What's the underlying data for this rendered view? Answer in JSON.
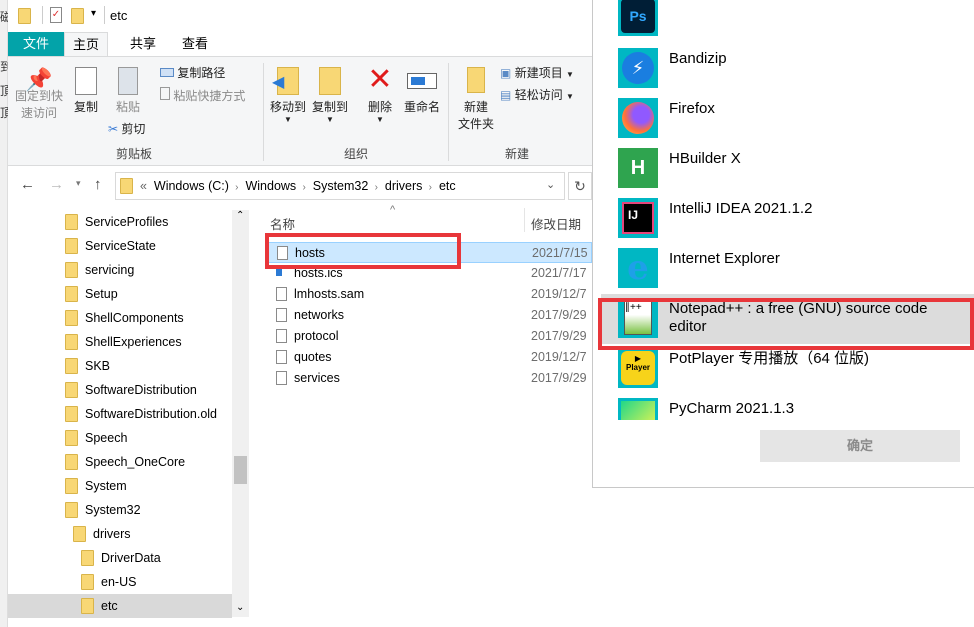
{
  "background_fragments": [
    "磁",
    "到",
    "頂",
    "頂"
  ],
  "explorer": {
    "title": "etc",
    "tabs": [
      "文件",
      "主页",
      "共享",
      "查看"
    ],
    "ribbon": {
      "pin": [
        "固定到快",
        "速访问"
      ],
      "copy": "复制",
      "paste": "粘贴",
      "copy_path": "复制路径",
      "paste_shortcut": "粘贴快捷方式",
      "cut": "剪切",
      "group_clipboard": "剪贴板",
      "move_to": "移动到",
      "copy_to": "复制到",
      "delete": "删除",
      "rename": "重命名",
      "group_organize": "组织",
      "new_folder": [
        "新建",
        "文件夹"
      ],
      "new_item": "新建项目",
      "easy_access": "轻松访问",
      "group_new": "新建"
    },
    "address": {
      "prefix": "«",
      "crumbs": [
        "Windows (C:)",
        "Windows",
        "System32",
        "drivers",
        "etc"
      ]
    },
    "tree": [
      {
        "label": "ServiceProfiles",
        "level": 0
      },
      {
        "label": "ServiceState",
        "level": 0
      },
      {
        "label": "servicing",
        "level": 0
      },
      {
        "label": "Setup",
        "level": 0
      },
      {
        "label": "ShellComponents",
        "level": 0
      },
      {
        "label": "ShellExperiences",
        "level": 0
      },
      {
        "label": "SKB",
        "level": 0
      },
      {
        "label": "SoftwareDistribution",
        "level": 0
      },
      {
        "label": "SoftwareDistribution.old",
        "level": 0
      },
      {
        "label": "Speech",
        "level": 0
      },
      {
        "label": "Speech_OneCore",
        "level": 0
      },
      {
        "label": "System",
        "level": 0
      },
      {
        "label": "System32",
        "level": 0
      },
      {
        "label": "drivers",
        "level": 1
      },
      {
        "label": "DriverData",
        "level": 2
      },
      {
        "label": "en-US",
        "level": 2
      },
      {
        "label": "etc",
        "level": 2,
        "selected": true
      }
    ],
    "columns": {
      "name": "名称",
      "date": "修改日期"
    },
    "files": [
      {
        "name": "hosts",
        "date": "2021/7/15",
        "selected": true
      },
      {
        "name": "hosts.ics",
        "date": "2021/7/17"
      },
      {
        "name": "lmhosts.sam",
        "date": "2019/12/7"
      },
      {
        "name": "networks",
        "date": "2017/9/29"
      },
      {
        "name": "protocol",
        "date": "2017/9/29"
      },
      {
        "name": "quotes",
        "date": "2019/12/7"
      },
      {
        "name": "services",
        "date": "2017/9/29"
      }
    ]
  },
  "dialog": {
    "apps": [
      {
        "name": "",
        "icon": "photoshop-icon"
      },
      {
        "name": "Bandizip",
        "icon": "bandizip-icon"
      },
      {
        "name": "Firefox",
        "icon": "firefox-icon"
      },
      {
        "name": "HBuilder X",
        "icon": "hbuilder-icon"
      },
      {
        "name": "IntelliJ IDEA 2021.1.2",
        "icon": "intellij-icon"
      },
      {
        "name": "Internet Explorer",
        "icon": "ie-icon"
      },
      {
        "name": "Notepad++ : a free (GNU) source code editor",
        "icon": "notepadpp-icon",
        "highlighted": true
      },
      {
        "name": "PotPlayer 专用播放（64 位版)",
        "icon": "potplayer-icon"
      },
      {
        "name": "PyCharm 2021.1.3",
        "icon": "pycharm-icon"
      }
    ],
    "ok_button": "确定",
    "colors": {
      "tile": "#00b7c3",
      "highlight": "#e8363a"
    }
  }
}
